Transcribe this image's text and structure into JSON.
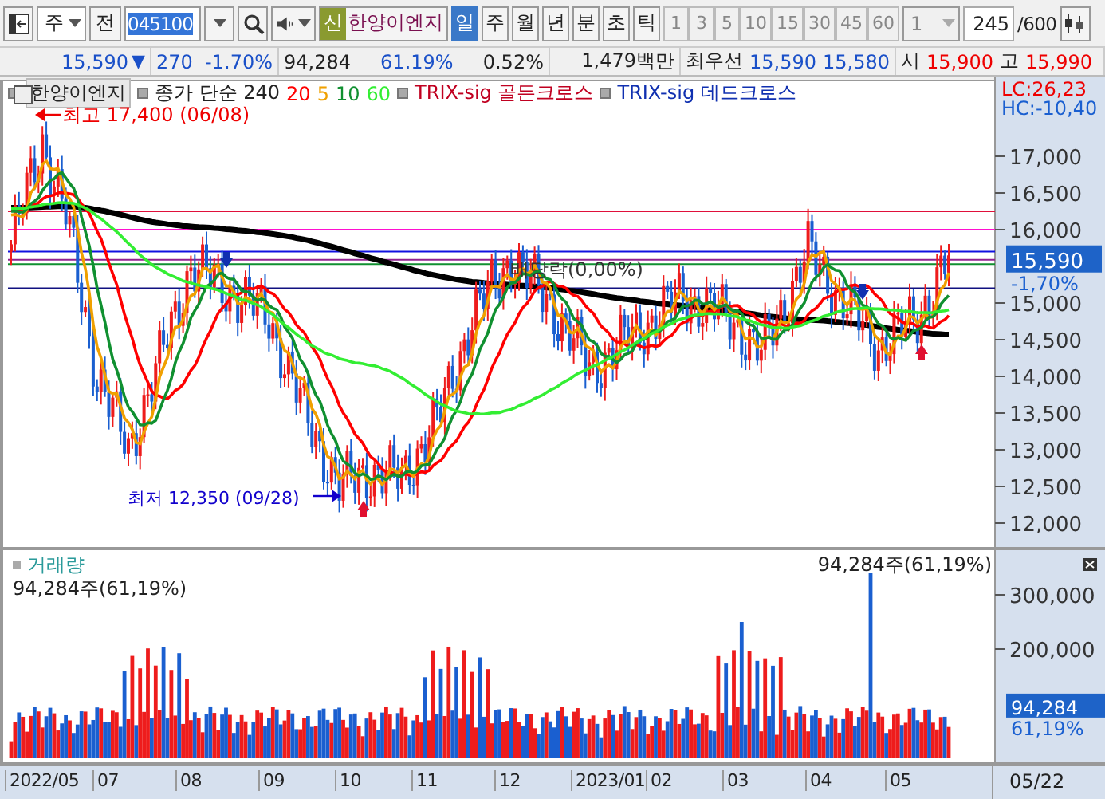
{
  "toolbar": {
    "period_type": "주",
    "prev_button": "전",
    "code": "045100",
    "new_badge": "신",
    "stock_name": "한양이엔지",
    "periods": [
      {
        "label": "일",
        "selected": true
      },
      {
        "label": "주",
        "selected": false
      },
      {
        "label": "월",
        "selected": false
      },
      {
        "label": "년",
        "selected": false
      },
      {
        "label": "분",
        "selected": false
      },
      {
        "label": "초",
        "selected": false
      },
      {
        "label": "틱",
        "selected": false
      }
    ],
    "intervals": [
      "1",
      "3",
      "5",
      "10",
      "15",
      "30",
      "45",
      "60"
    ],
    "interval_value": "1",
    "count": "245",
    "count_max": "/600"
  },
  "quote": {
    "price": "15,590",
    "arrow": "▼",
    "change": "270",
    "change_rate": "-1.70%",
    "volume": "94,284",
    "volume_rate": "61.19%",
    "turnover": "0.52%",
    "amount": "1,479백만",
    "best_label": "최우선",
    "ask": "15,590",
    "bid": "15,580",
    "open_label": "시",
    "open": "15,900",
    "high_label": "고",
    "high": "15,990"
  },
  "price_chart": {
    "legend": {
      "name": "한양이엔지",
      "ma_label": "종가 단순 240",
      "ma_periods": [
        {
          "label": "20",
          "color": "#ff0000"
        },
        {
          "label": "5",
          "color": "#f0a000"
        },
        {
          "label": "10",
          "color": "#109030"
        },
        {
          "label": "60",
          "color": "#33ee33"
        }
      ],
      "signals": [
        {
          "label": "TRIX-sig 골든크로스",
          "color": "#c00020"
        },
        {
          "label": "TRIX-sig 데드크로스",
          "color": "#1030b0"
        }
      ]
    },
    "high_note": "최고 17,400 (06/08)",
    "low_note": "최저 12,350 (09/28)",
    "dividend_note": "배당락(0,00%)",
    "lc": "LC:26,23",
    "hc": "HC:-10,40",
    "yticks": [
      "17,000",
      "16,500",
      "16,000",
      "15,000",
      "14,500",
      "14,000",
      "13,500",
      "13,000",
      "12,500",
      "12,000"
    ],
    "last_price": "15,590",
    "last_change": "-1,70%"
  },
  "volume_chart": {
    "title": "거래량",
    "left_note": "94,284주(61,19%)",
    "right_note": "94,284주(61,19%)",
    "yticks": [
      "300,000",
      "200,000"
    ],
    "last_volume": "94,284",
    "last_rate": "61,19%"
  },
  "date_axis": {
    "labels": [
      "2022/05",
      "07",
      "08",
      "09",
      "10",
      "11",
      "12",
      "2023/01",
      "02",
      "03",
      "04",
      "05"
    ],
    "current": "05/22"
  }
}
